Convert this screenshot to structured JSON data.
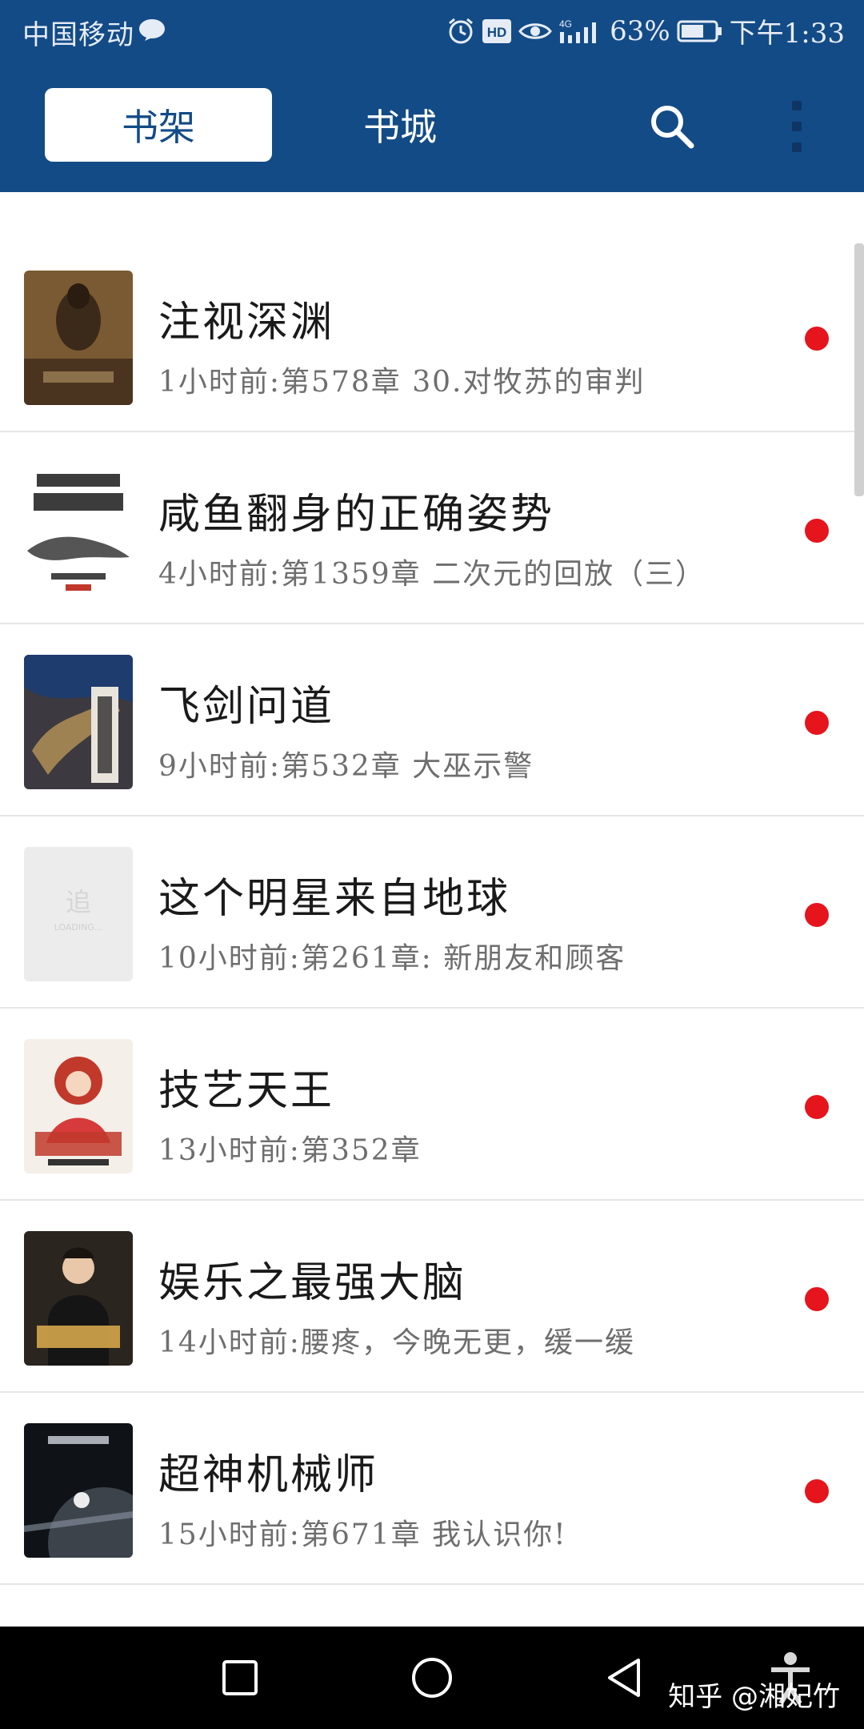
{
  "status_bar": {
    "carrier": "中国移动",
    "battery_percent": "63%",
    "time": "下午1:33",
    "icons": [
      "message-icon",
      "alarm-icon",
      "hd-icon",
      "eye-icon",
      "signal-4g-icon",
      "battery-icon"
    ]
  },
  "app_bar": {
    "tabs": [
      {
        "label": "书架",
        "active": true
      },
      {
        "label": "书城",
        "active": false
      }
    ],
    "icons": [
      "search-icon",
      "more-icon"
    ]
  },
  "books": [
    {
      "title": "注视深渊",
      "update": "1小时前:第578章 30.对牧苏的审判",
      "unread": true
    },
    {
      "title": "咸鱼翻身的正确姿势",
      "update": "4小时前:第1359章 二次元的回放（三）",
      "unread": true
    },
    {
      "title": "飞剑问道",
      "update": "9小时前:第532章 大巫示警",
      "unread": true
    },
    {
      "title": "这个明星来自地球",
      "update": "10小时前:第261章: 新朋友和顾客",
      "unread": true,
      "cover_placeholder": {
        "glyph": "追",
        "caption": "LOADING..."
      }
    },
    {
      "title": "技艺天王",
      "update": "13小时前:第352章",
      "unread": true
    },
    {
      "title": "娱乐之最强大脑",
      "update": "14小时前:腰疼，今晚无更，缓一缓",
      "unread": true
    },
    {
      "title": "超神机械师",
      "update": "15小时前:第671章 我认识你!",
      "unread": true
    }
  ],
  "nav_bar": {
    "icons": [
      "recent-apps-icon",
      "home-icon",
      "back-icon",
      "accessibility-icon"
    ],
    "watermark": "知乎 @湘妃竹"
  },
  "colors": {
    "header": "#134b87",
    "unread_dot": "#e6141c",
    "title_text": "#1a1a1a",
    "subtitle_text": "#6e6e6e"
  }
}
